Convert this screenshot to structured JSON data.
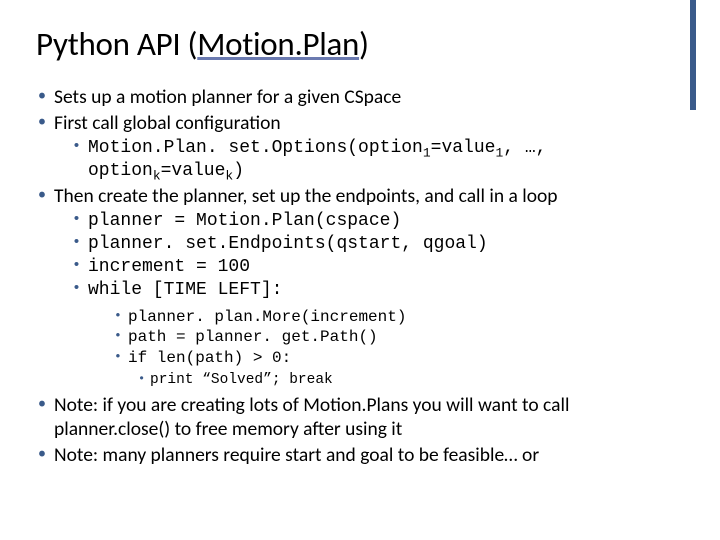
{
  "title": {
    "prefix": "Python API (",
    "link": "Motion.Plan",
    "suffix": ")"
  },
  "bullets": {
    "b1": "Sets up a motion planner for a given CSpace",
    "b2": "First call global configuration",
    "b2_sub": "Motion.Plan. set.Options(option",
    "b2_sub_mid1": "=value",
    "b2_sub_mid2": ", …, option",
    "b2_sub_mid3": "=value",
    "b2_sub_end": ")",
    "sub1": "1",
    "subk": "k",
    "b3": "Then create the planner, set up the endpoints, and call in a loop",
    "b3a": "planner = Motion.Plan(cspace)",
    "b3b": "planner. set.Endpoints(qstart, qgoal)",
    "b3c": "increment = 100",
    "b3d": "while [TIME LEFT]:",
    "b3d1": "planner. plan.More(increment)",
    "b3d2": "path = planner. get.Path()",
    "b3d3": "if len(path) > 0:",
    "b3d3a": "print “Solved”; break",
    "b4": "Note: if you are creating lots of Motion.Plans you will want to call planner.close() to free memory after using it",
    "b5": "Note: many planners require start and goal to be feasible… or"
  }
}
